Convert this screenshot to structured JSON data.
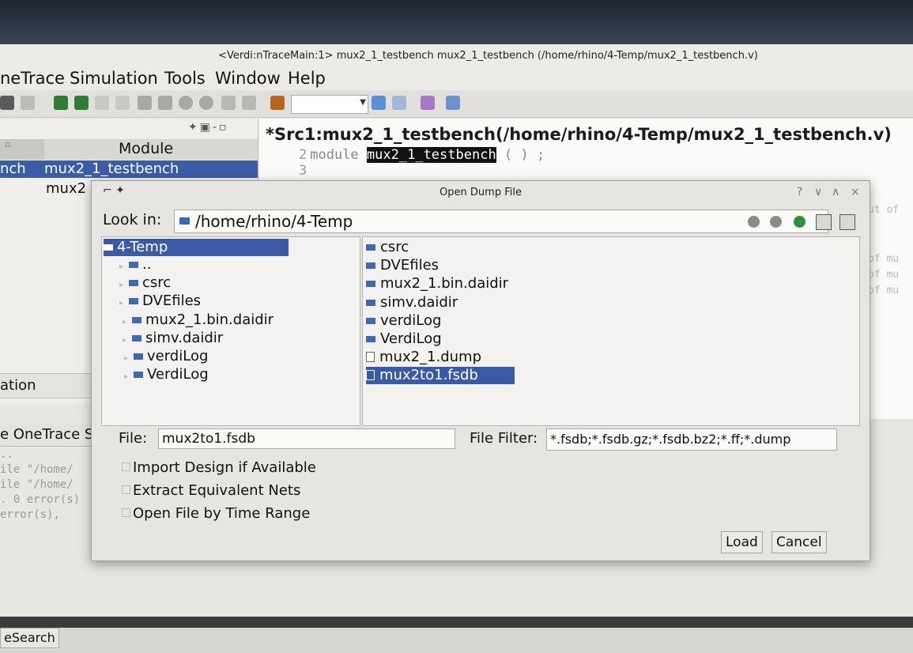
{
  "window": {
    "title": "<Verdi:nTraceMain:1> mux2_1_testbench mux2_1_testbench (/home/rhino/4-Temp/mux2_1_testbench.v)"
  },
  "menubar": {
    "items": [
      "neTrace",
      "Simulation",
      "Tools",
      "Window",
      "Help"
    ]
  },
  "module_pane": {
    "column_header": "Module",
    "row1_left": "nch",
    "row1_module": "mux2_1_testbench",
    "row2_module": "mux2",
    "section_label": "ation"
  },
  "source_pane": {
    "title": "*Src1:mux2_1_testbench(/home/rhino/4-Temp/mux2_1_testbench.v)",
    "line2_num": "2",
    "line2_keyword": "module",
    "line2_name": "mux2_1_testbench",
    "line2_rest": " ( ) ;",
    "line3_num": "3",
    "side_text": [
      "ut of",
      "of mu",
      "of mu",
      "of mu"
    ]
  },
  "lower_pane": {
    "tabs": "e OneTrace Se",
    "console_lines": [
      "..",
      "ile \"/home/",
      "ile \"/home/",
      ". 0 error(s)",
      " error(s),"
    ]
  },
  "status_bar": {
    "search_label": "eSearch"
  },
  "dialog": {
    "title": "Open Dump File",
    "controls": [
      "?",
      "∨",
      "∧",
      "×"
    ],
    "look_in_label": "Look in:",
    "look_in_path": "/home/rhino/4-Temp",
    "tree": {
      "root": "4-Temp",
      "children": [
        "..",
        "csrc",
        "DVEfiles",
        "mux2_1.bin.daidir",
        "simv.daidir",
        "verdiLog",
        "VerdiLog"
      ]
    },
    "files": [
      {
        "name": "csrc",
        "kind": "folder"
      },
      {
        "name": "DVEfiles",
        "kind": "folder"
      },
      {
        "name": "mux2_1.bin.daidir",
        "kind": "folder"
      },
      {
        "name": "simv.daidir",
        "kind": "folder"
      },
      {
        "name": "verdiLog",
        "kind": "folder"
      },
      {
        "name": "VerdiLog",
        "kind": "folder"
      },
      {
        "name": "mux2_1.dump",
        "kind": "file"
      },
      {
        "name": "mux2to1.fsdb",
        "kind": "file",
        "selected": true
      }
    ],
    "file_label": "File:",
    "file_value": "mux2to1.fsdb",
    "filter_label": "File Filter:",
    "filter_value": "*.fsdb;*.fsdb.gz;*.fsdb.bz2;*.ff;*.dump",
    "options": [
      "Import Design if Available",
      "Extract Equivalent Nets",
      "Open File by Time Range"
    ],
    "load_label": "Load",
    "cancel_label": "Cancel"
  }
}
